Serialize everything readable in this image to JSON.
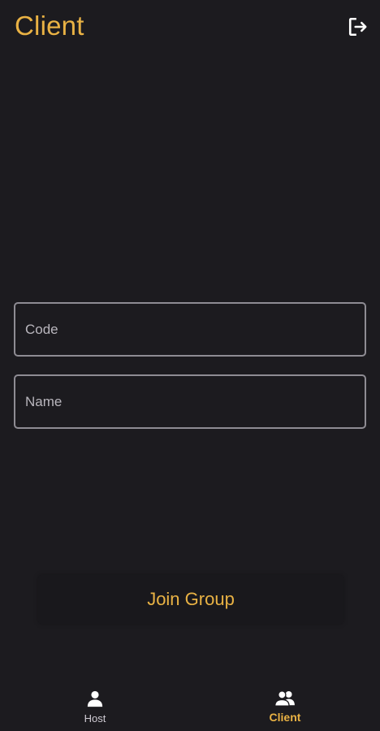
{
  "app_bar": {
    "title": "Client",
    "logout_icon": "logout-icon"
  },
  "form": {
    "code": {
      "placeholder": "Code",
      "value": ""
    },
    "name": {
      "placeholder": "Name",
      "value": ""
    }
  },
  "actions": {
    "join_label": "Join Group"
  },
  "bottom_nav": {
    "items": [
      {
        "label": "Host",
        "icon": "person-icon",
        "active": false
      },
      {
        "label": "Client",
        "icon": "people-icon",
        "active": true
      }
    ]
  },
  "colors": {
    "background": "#1c1b1f",
    "accent": "#e9b244",
    "outline": "#8e8c93",
    "text": "#e6e1e5"
  }
}
